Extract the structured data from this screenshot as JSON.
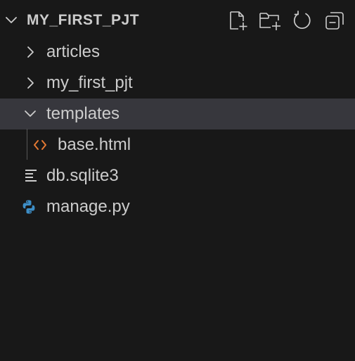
{
  "explorer": {
    "folder_title": "MY_FIRST_PJT",
    "actions": [
      {
        "name": "new-file-icon"
      },
      {
        "name": "new-folder-icon"
      },
      {
        "name": "refresh-icon"
      },
      {
        "name": "collapse-all-icon"
      }
    ],
    "items": [
      {
        "label": "articles",
        "type": "folder",
        "expanded": false
      },
      {
        "label": "my_first_pjt",
        "type": "folder",
        "expanded": false
      },
      {
        "label": "templates",
        "type": "folder",
        "expanded": true,
        "selected": true
      },
      {
        "label": "base.html",
        "type": "html-file"
      },
      {
        "label": "db.sqlite3",
        "type": "text-file"
      },
      {
        "label": "manage.py",
        "type": "python-file"
      }
    ]
  },
  "colors": {
    "background": "#181818",
    "selected_row": "#37373d",
    "text": "#cccccc",
    "html_icon": "#e37933",
    "python_icon": "#3d8ec7"
  }
}
